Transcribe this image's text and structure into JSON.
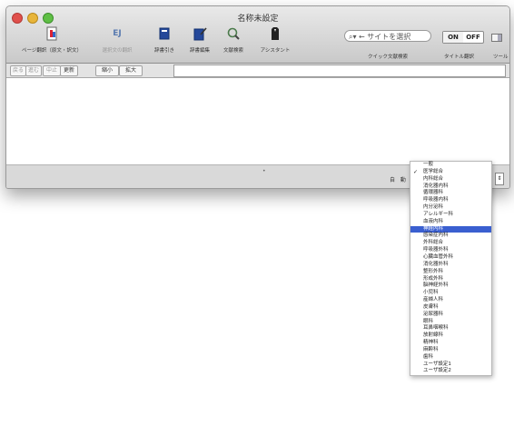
{
  "window": {
    "title": "名称未設定"
  },
  "toolbar": [
    {
      "label": "ページ翻訳（原文・訳文）",
      "icon": "page-translate-icon",
      "dim": false
    },
    {
      "label": "選択文の翻訳",
      "icon": "ej-translate-icon",
      "icon_text": "EJ",
      "dim": true
    },
    {
      "label": "辞書引き",
      "icon": "dictionary-icon",
      "dim": false
    },
    {
      "label": "辞書編集",
      "icon": "dictionary-edit-icon",
      "dim": false
    },
    {
      "label": "文献検索",
      "icon": "magnifier-icon",
      "dim": false
    },
    {
      "label": "アシスタント",
      "icon": "assistant-icon",
      "dim": false
    }
  ],
  "search": {
    "placeholder": "← サイトを選択",
    "label": "クイック文献検索"
  },
  "toggle": {
    "on": "ON",
    "off": "OFF",
    "label": "タイトル翻訳"
  },
  "tools_label": "ツール",
  "nav": {
    "back": "戻る",
    "forward": "進む",
    "stop": "中止",
    "reload": "更新",
    "shrink": "縮小",
    "enlarge": "拡大"
  },
  "status": {
    "mode": "自 動"
  },
  "dropdown": {
    "selected": "神経内科",
    "checked": "医学総合",
    "items": [
      "一般",
      "医学総合",
      "内科総合",
      "消化器内科",
      "循環器科",
      "呼吸器内科",
      "内分泌科",
      "アレルギー科",
      "血液内科",
      "神経内科",
      "感染症内科",
      "外科総合",
      "呼吸器外科",
      "心臓血管外科",
      "消化器外科",
      "整形外科",
      "形成外科",
      "脳神経外科",
      "小児科",
      "産婦人科",
      "皮膚科",
      "泌尿器科",
      "眼科",
      "耳鼻咽喉科",
      "放射線科",
      "精神科",
      "麻酔科",
      "歯科",
      "ユーザ設定1",
      "ユーザ設定2"
    ]
  },
  "colors": {
    "selection": "#3a5fd0",
    "chrome": "#ececec"
  }
}
